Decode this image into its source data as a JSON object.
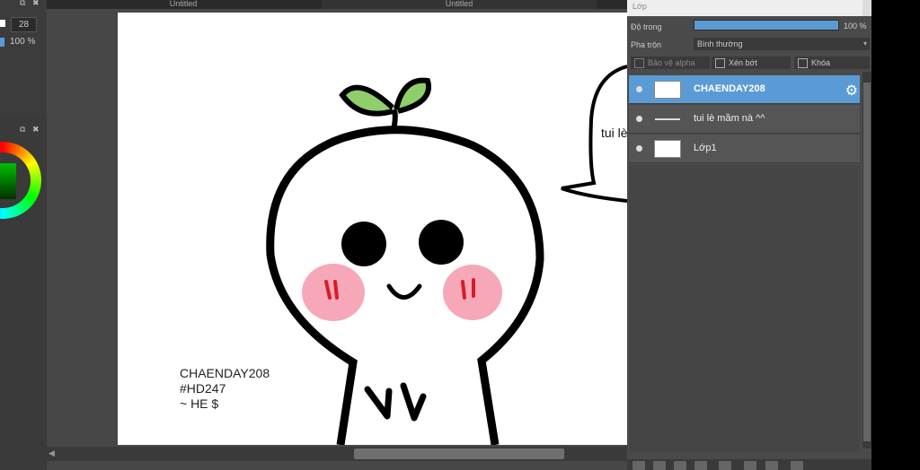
{
  "tabs": [
    "Untitled",
    "Untitled"
  ],
  "brush": {
    "size": "28",
    "opacity": "100 %"
  },
  "canvas": {
    "speech_text": "tui lè",
    "watermark": [
      "CHAENDAY208",
      "#HD247",
      "~ HE $"
    ]
  },
  "layers_panel": {
    "title": "Lớp",
    "opacity_label": "Độ trong",
    "opacity_value": "100 %",
    "opacity_fraction": 1.0,
    "blend_label": "Pha trộn",
    "blend_value": "Bình thường",
    "checkboxes": [
      "Bảo vệ alpha",
      "Xén bớt",
      "Khóa"
    ],
    "layers": [
      {
        "name": "CHAENDAY208",
        "active": true
      },
      {
        "name": "tui lè mầm nà ^^",
        "active": false
      },
      {
        "name": "Lớp1",
        "active": false
      }
    ]
  },
  "colors": {
    "accent": "#5b9bd5",
    "panel": "#4a4a4a",
    "blush": "#f7a8b8",
    "sprout": "#8fce6a"
  },
  "icons": [
    "popout-icon",
    "close-icon",
    "gear-icon",
    "eye-icon",
    "chevron-down-icon"
  ]
}
